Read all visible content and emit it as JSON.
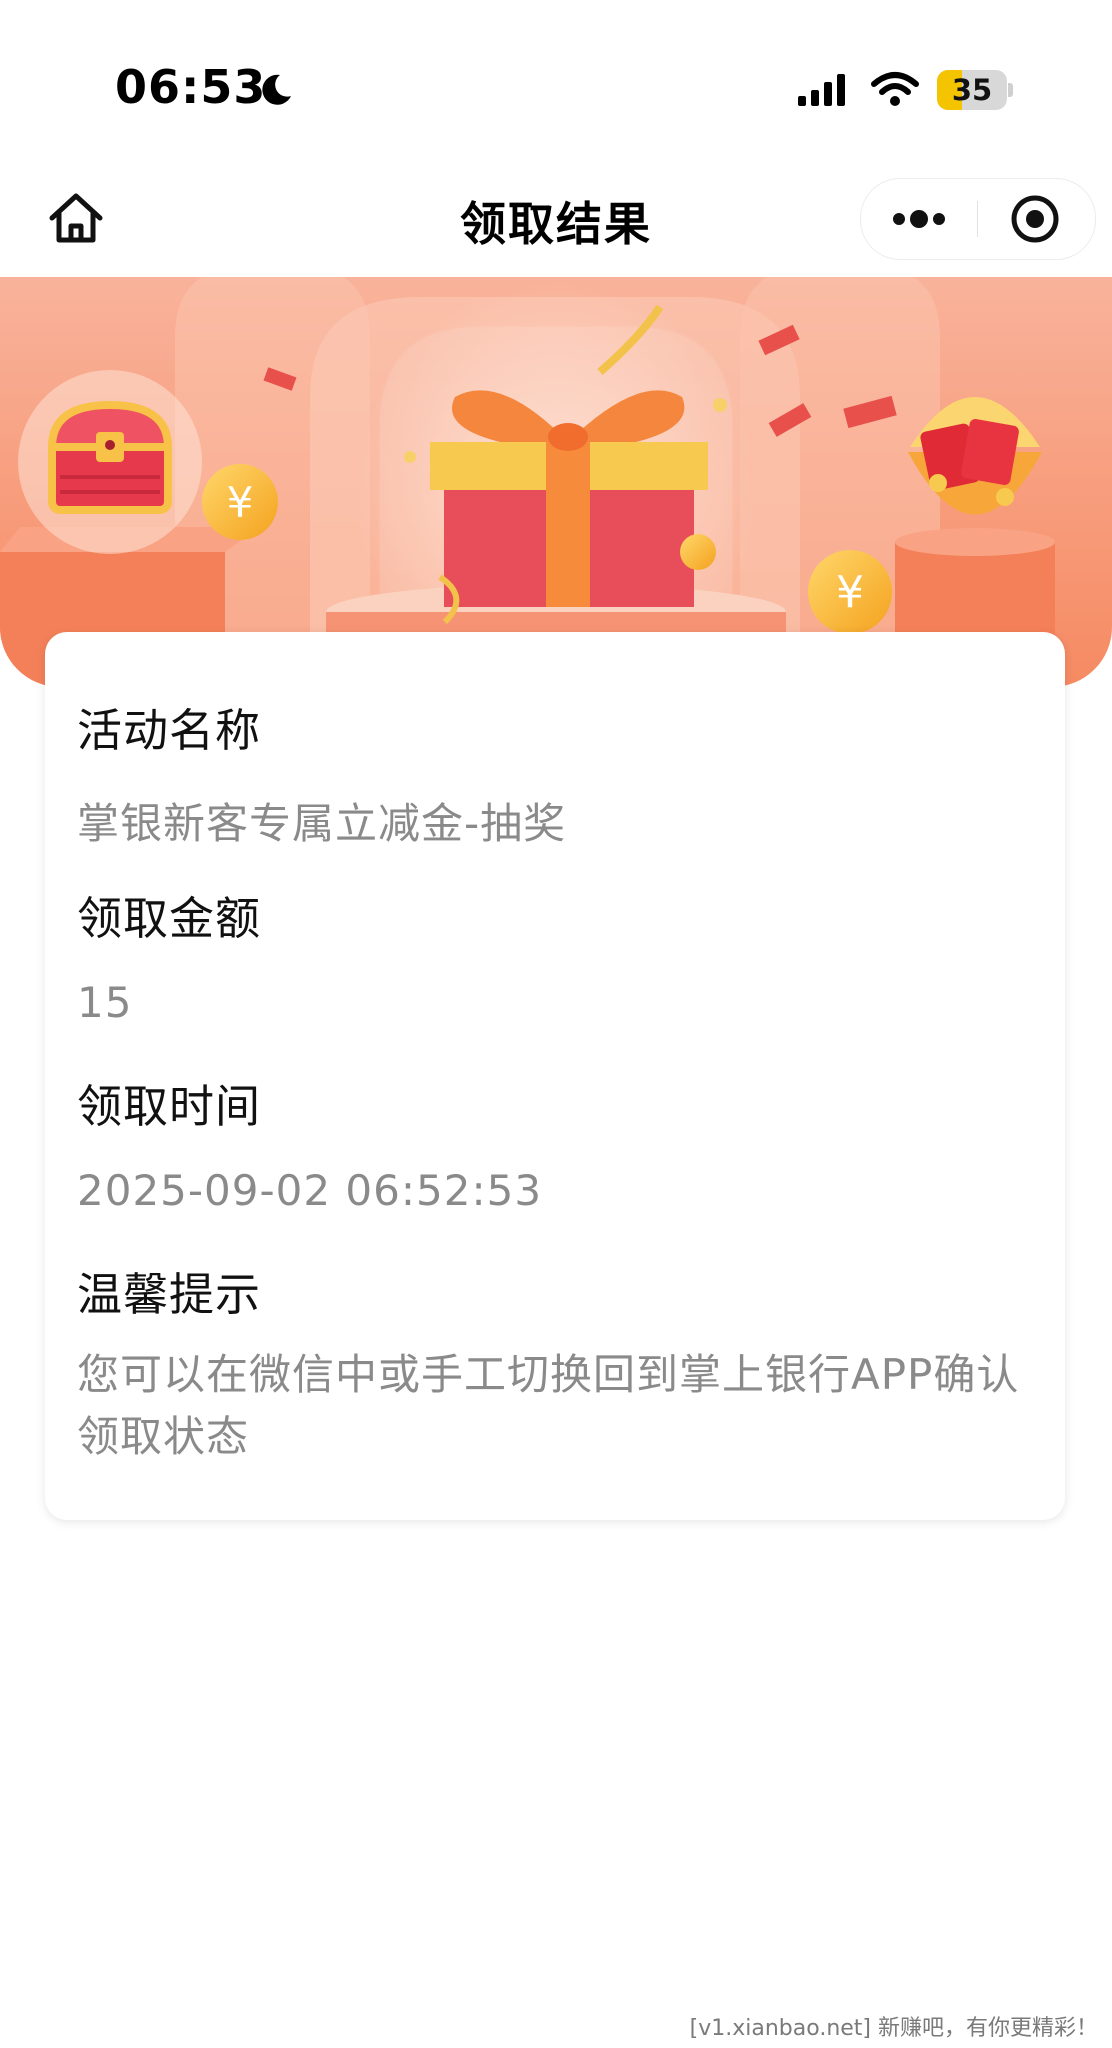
{
  "status_bar": {
    "time": "06:53",
    "battery_level": "35",
    "battery_fraction": 0.35,
    "icons": [
      "moon-icon",
      "signal-icon",
      "wifi-icon",
      "battery-icon"
    ]
  },
  "nav": {
    "title": "领取结果",
    "icons": [
      "home-icon",
      "more-dots-icon",
      "target-close-icon"
    ]
  },
  "banner": {
    "elements": [
      "treasure-chest-icon",
      "gift-box-icon",
      "red-envelope-bowl-icon",
      "coin-icon"
    ]
  },
  "card": {
    "fields": [
      {
        "label": "活动名称",
        "value": "掌银新客专属立减金-抽奖"
      },
      {
        "label": "领取金额",
        "value": "15"
      },
      {
        "label": "领取时间",
        "value": "2025-09-02 06:52:53"
      },
      {
        "label": "温馨提示",
        "value": "您可以在微信中或手工切换回到掌上银行APP确认领取状态"
      }
    ]
  },
  "watermark": "[v1.xianbao.net] 新赚吧，有你更精彩！",
  "colors": {
    "banner_bg": "#f7a98c",
    "gift_red": "#e84e5a",
    "gold": "#f6b43a",
    "battery_yellow": "#f5c400",
    "value_gray": "#8a8a8a"
  }
}
